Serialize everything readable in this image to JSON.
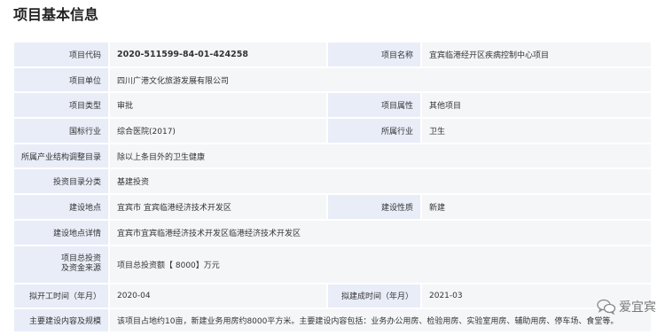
{
  "page_title": "项目基本信息",
  "rows": [
    {
      "l1": "项目代码",
      "v1": "2020-511599-84-01-424258",
      "l2": "项目名称",
      "v2": "宜宾临港经开区疾病控制中心项目"
    },
    {
      "l1": "项目单位",
      "v1": "四川广港文化旅游发展有限公司"
    },
    {
      "l1": "项目类型",
      "v1": "审批",
      "l2": "项目属性",
      "v2": "其他项目"
    },
    {
      "l1": "国标行业",
      "v1": "综合医院(2017)",
      "l2": "所属行业",
      "v2": "卫生"
    },
    {
      "l1": "所属产业结构调整目录",
      "v1": "除以上条目外的卫生健康"
    },
    {
      "l1": "投资目录分类",
      "v1": "基建投资"
    },
    {
      "l1": "建设地点",
      "v1": "宜宾市 宜宾临港经济技术开发区",
      "l2": "建设性质",
      "v2": "新建"
    },
    {
      "l1": "建设地点详情",
      "v1": "宜宾市宜宾临港经济技术开发区临港经济技术开发区"
    },
    {
      "l1a": "项目总投资",
      "l1b": "及资金来源",
      "v1": "项目总投资额【 8000】万元"
    },
    {
      "l1": "拟开工时间（年月）",
      "v1": "2020-04",
      "l2": "拟建成时间（年月）",
      "v2": "2021-03"
    },
    {
      "l1": "主要建设内容及规模",
      "v1": "该项目占地约10亩，新建业务用房约8000平方米。主要建设内容包括：业务办公用房、检验用房、实验室用房、辅助用房、停车场、食堂等。"
    }
  ],
  "watermark": {
    "text": "爱宜宾",
    "icon": "wechat-icon"
  }
}
